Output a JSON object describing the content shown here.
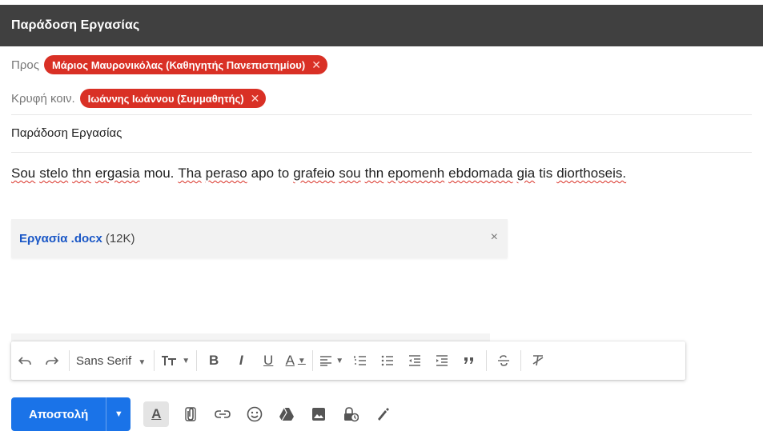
{
  "header": {
    "title": "Παράδοση Εργασίας"
  },
  "recipients": {
    "to_label": "Προς",
    "to_chip": "Μάριος Μαυρονικόλας (Καθηγητής Πανεπιστημίου)",
    "bcc_label": "Κρυφή κοιν.",
    "bcc_chip": "Ιωάννης Ιωάννου (Συμμαθητής)",
    "chip_color": "#d93025"
  },
  "subject": "Παράδοση Εργασίας",
  "body": {
    "words": [
      {
        "t": "Sou",
        "sp": true
      },
      {
        "t": "stelo",
        "sp": true
      },
      {
        "t": "thn",
        "sp": true
      },
      {
        "t": "ergasia",
        "sp": true
      },
      {
        "t": "mou.",
        "sp": false
      },
      {
        "t": "Tha",
        "sp": true
      },
      {
        "t": "peraso",
        "sp": true
      },
      {
        "t": "apo",
        "sp": false
      },
      {
        "t": "to",
        "sp": false
      },
      {
        "t": "grafeio",
        "sp": true
      },
      {
        "t": "sou",
        "sp": true
      },
      {
        "t": "thn",
        "sp": true
      },
      {
        "t": "epomenh",
        "sp": true
      },
      {
        "t": "ebdomada",
        "sp": true
      },
      {
        "t": "gia",
        "sp": true
      },
      {
        "t": "tis",
        "sp": false
      },
      {
        "t": "diorthoseis.",
        "sp": true
      }
    ]
  },
  "attachment": {
    "name": "Εργασία .docx",
    "size": "(12K)",
    "close_glyph": "×"
  },
  "toolbar": {
    "font": "Sans Serif",
    "caret": "▼"
  },
  "compose": {
    "send_label": "Αποστολή",
    "send_dropdown": "▼",
    "accent_color": "#1a73e8",
    "icons": [
      "text-formatting-icon",
      "attach-icon",
      "link-icon",
      "emoji-icon",
      "drive-icon",
      "photo-icon",
      "confidential-icon",
      "signature-icon"
    ]
  },
  "close_glyph": "✕"
}
